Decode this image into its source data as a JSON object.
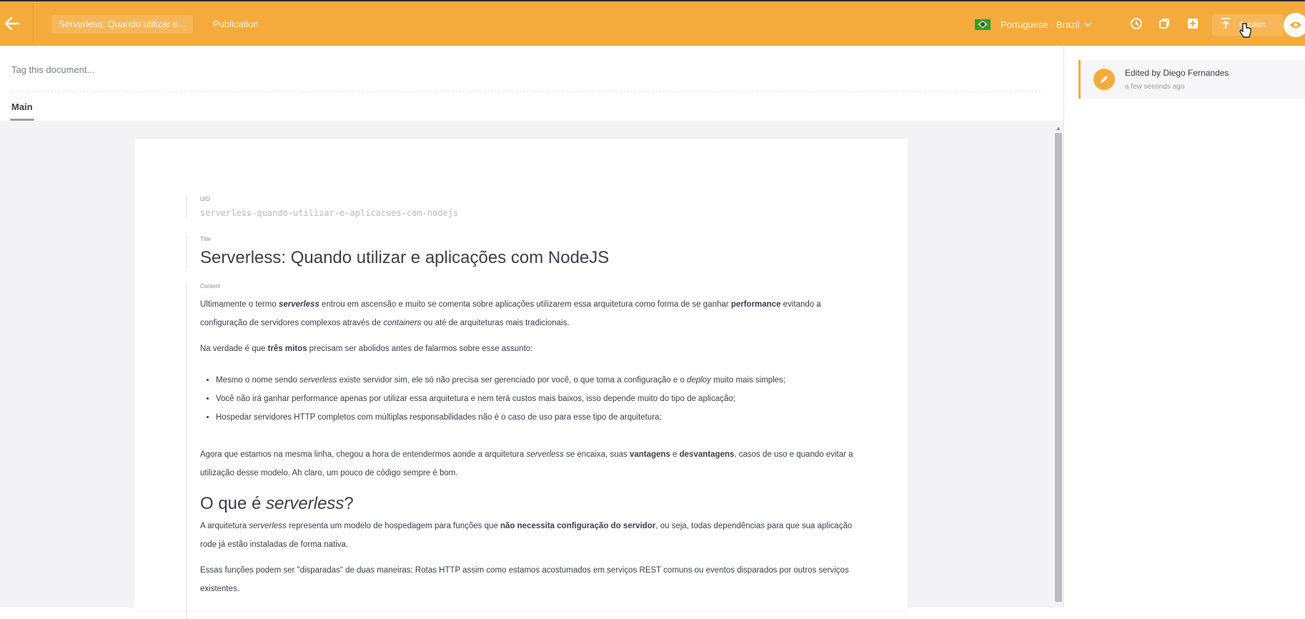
{
  "topbar": {
    "back_icon": "arrow-left-icon",
    "document_title": "Serverless: Quando utilizar e...",
    "publication_tab": "Publication",
    "language": "Portuguese - Brazil",
    "icons": [
      "history-icon",
      "duplicate-icon",
      "save-icon",
      "publish-icon"
    ],
    "publish_label": "Publish",
    "preview_icon": "eye-icon",
    "accent_color": "#f5ab3c"
  },
  "editor": {
    "tag_placeholder": "Tag this document...",
    "tab_main": "Main"
  },
  "document": {
    "uid_label": "UID",
    "uid_value": "serverless-quando-utilizar-e-aplicacoes-com-nodejs",
    "title_label": "Title",
    "title_value": "Serverless: Quando utilizar e aplicações com NodeJS",
    "content_label": "Content",
    "p1": {
      "a": "Ultimamente o termo ",
      "b": "serverless",
      "c": " entrou em ascensão e muito se comenta sobre aplicações utilizarem essa arquitetura como forma de se ganhar ",
      "d": "performance",
      "e": " evitando a configuração de servidores complexos através de ",
      "f": "containers",
      "g": " ou até de arquiteturas mais tradicionais."
    },
    "p2": {
      "a": "Na verdade é que ",
      "b": "três mitos",
      "c": " precisam ser abolidos antes de falarmos sobre esse assunto:"
    },
    "bullets": {
      "b1": {
        "a": "Mesmo o nome sendo ",
        "b": "serverless",
        "c": " existe servidor sim, ele só não precisa ser gerenciado por você, o que toma a configuração e o ",
        "d": "deploy",
        "e": " muito mais simples;"
      },
      "b2": "Você não irá ganhar performance apenas por utilizar essa arquitetura e nem terá custos mais baixos, isso depende muito do tipo de aplicação;",
      "b3": "Hospedar servidores HTTP completos com múltiplas responsabilidades não é o caso de uso para esse tipo de arquitetura;"
    },
    "p3": {
      "a": "Agora que estamos na mesma linha, chegou a hora de entendermos aonde a arquitetura ",
      "b": "serverless",
      "c": " se encaixa, suas ",
      "d": "vantagens",
      "e": " e ",
      "f": "desvantagens",
      "g": ", casos de uso e quando evitar a utilização desse modelo. Ah claro, um pouco de código sempre é bom."
    },
    "h2": {
      "a": "O que é ",
      "b": "serverless",
      "c": "?"
    },
    "p4": {
      "a": "A arquitetura ",
      "b": "serverless",
      "c": " representa um modelo de hospedagem para funções que ",
      "d": "não necessita configuração do servidor",
      "e": ", ou seja, todas dependências para que sua aplicação rode já estão instaladas de forma nativa."
    },
    "p5": "Essas funções podem ser \"disparadas\" de duas maneiras: Rotas HTTP assim como estamos acostumados em serviços REST comuns ou eventos disparados por outros serviços existentes."
  },
  "history": {
    "entry_icon": "pencil-icon",
    "entry_title": "Edited by Diego Fernandes",
    "entry_time": "a few seconds ago"
  }
}
